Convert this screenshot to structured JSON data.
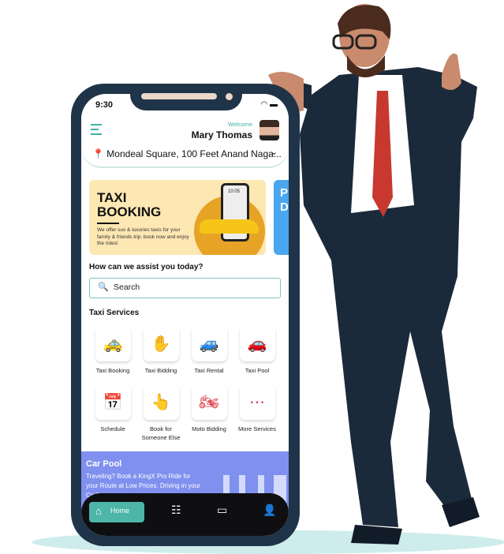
{
  "status": {
    "time": "9:30"
  },
  "header": {
    "welcome": "Welcome",
    "user_name": "Mary Thomas",
    "location": "Mondeal Square, 100 Feet Anand Naga..."
  },
  "banner": {
    "title_line1": "TAXI",
    "title_line2": "BOOKING",
    "description": "We offer suv & luxuries taxis for your family & friends trip. book now and enjoy the rides!",
    "phone_time": "10:05"
  },
  "banner2": {
    "title_partial": "P D"
  },
  "assist_heading": "How can we assist you today?",
  "search": {
    "placeholder": "Search"
  },
  "services": {
    "heading": "Taxi Services",
    "items": [
      {
        "label": "Taxi Booking",
        "icon": "taxi-icon",
        "color": "#f2a08a"
      },
      {
        "label": "Taxi Bidding",
        "icon": "bid-icon",
        "color": "#7b82e0"
      },
      {
        "label": "Taxi Rental",
        "icon": "rental-car-icon",
        "color": "#5aa8e6"
      },
      {
        "label": "Taxi Pool",
        "icon": "car-pool-icon",
        "color": "#3fb98e"
      },
      {
        "label": "Schedule",
        "icon": "calendar-icon",
        "color": "#a05a8c"
      },
      {
        "label": "Book for Someone Else",
        "icon": "hand-tap-icon",
        "color": "#e8b85c"
      },
      {
        "label": "Moto Bidding",
        "icon": "motorbike-icon",
        "color": "#e0505a"
      },
      {
        "label": "More Services",
        "icon": "more-icon",
        "color": "#d04050"
      }
    ]
  },
  "car_pool": {
    "title": "Car Pool",
    "description": "Traveling? Book a KingX Pro Ride for your Route at Low Prices. Driving in your Car?"
  },
  "nav": {
    "home": "Home"
  },
  "colors": {
    "accent": "#4db6a8",
    "phone_frame": "#1f3448",
    "pool_band": "#7f90ee",
    "banner_bg": "#fde7b3"
  }
}
